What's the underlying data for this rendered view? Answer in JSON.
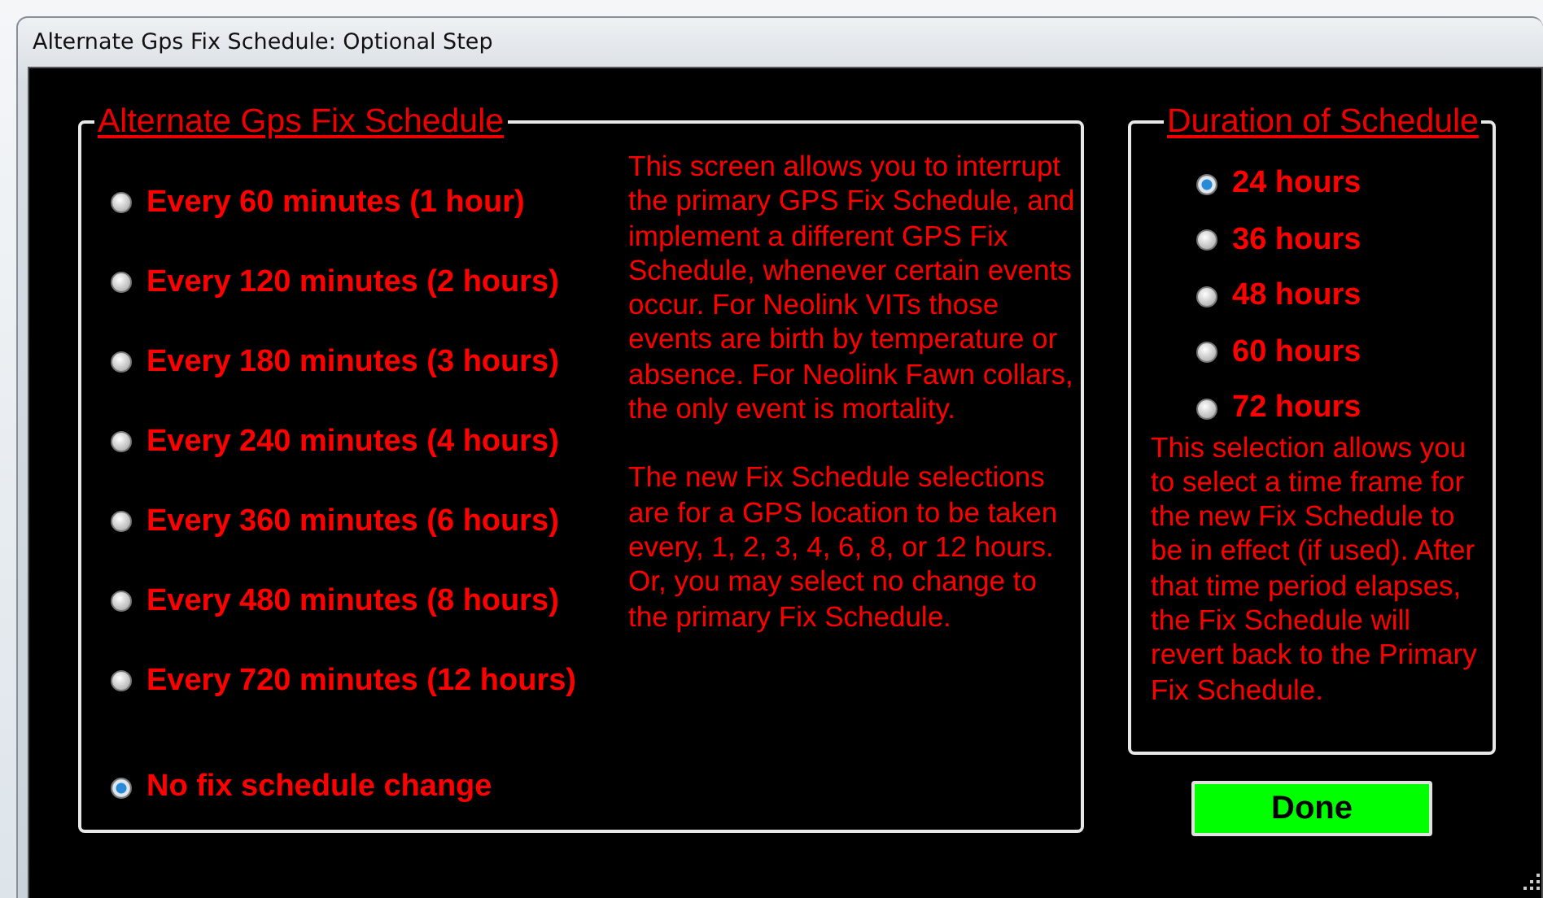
{
  "window": {
    "title": "Alternate Gps Fix Schedule: Optional Step"
  },
  "fix_schedule": {
    "title": "Alternate Gps Fix Schedule",
    "options": [
      {
        "label": "Every 60 minutes (1 hour)",
        "selected": false
      },
      {
        "label": "Every 120 minutes (2 hours)",
        "selected": false
      },
      {
        "label": "Every 180 minutes (3 hours)",
        "selected": false
      },
      {
        "label": "Every 240 minutes (4 hours)",
        "selected": false
      },
      {
        "label": "Every 360 minutes (6 hours)",
        "selected": false
      },
      {
        "label": "Every 480 minutes (8 hours)",
        "selected": false
      },
      {
        "label": "Every 720 minutes (12 hours)",
        "selected": false
      }
    ],
    "no_change_option": {
      "label": "No fix schedule change",
      "selected": true
    },
    "description": [
      "This screen allows you to interrupt the primary GPS Fix Schedule, and implement a different GPS Fix Schedule, whenever certain events occur. For Neolink VITs those events are birth by temperature or absence. For Neolink Fawn collars, the only event is mortality.",
      "The new Fix Schedule selections are for a GPS location to be taken every, 1, 2, 3, 4, 6, 8, or 12 hours. Or, you may select no change to the primary Fix Schedule."
    ]
  },
  "duration": {
    "title": "Duration of Schedule",
    "options": [
      {
        "label": "24 hours",
        "selected": true
      },
      {
        "label": "36 hours",
        "selected": false
      },
      {
        "label": "48 hours",
        "selected": false
      },
      {
        "label": "60 hours",
        "selected": false
      },
      {
        "label": "72 hours",
        "selected": false
      }
    ],
    "description": "This selection allows you to select a time frame for the new Fix Schedule to be in effect (if used). After that time period elapses, the Fix Schedule will revert back to the Primary Fix Schedule."
  },
  "buttons": [
    "Done"
  ]
}
